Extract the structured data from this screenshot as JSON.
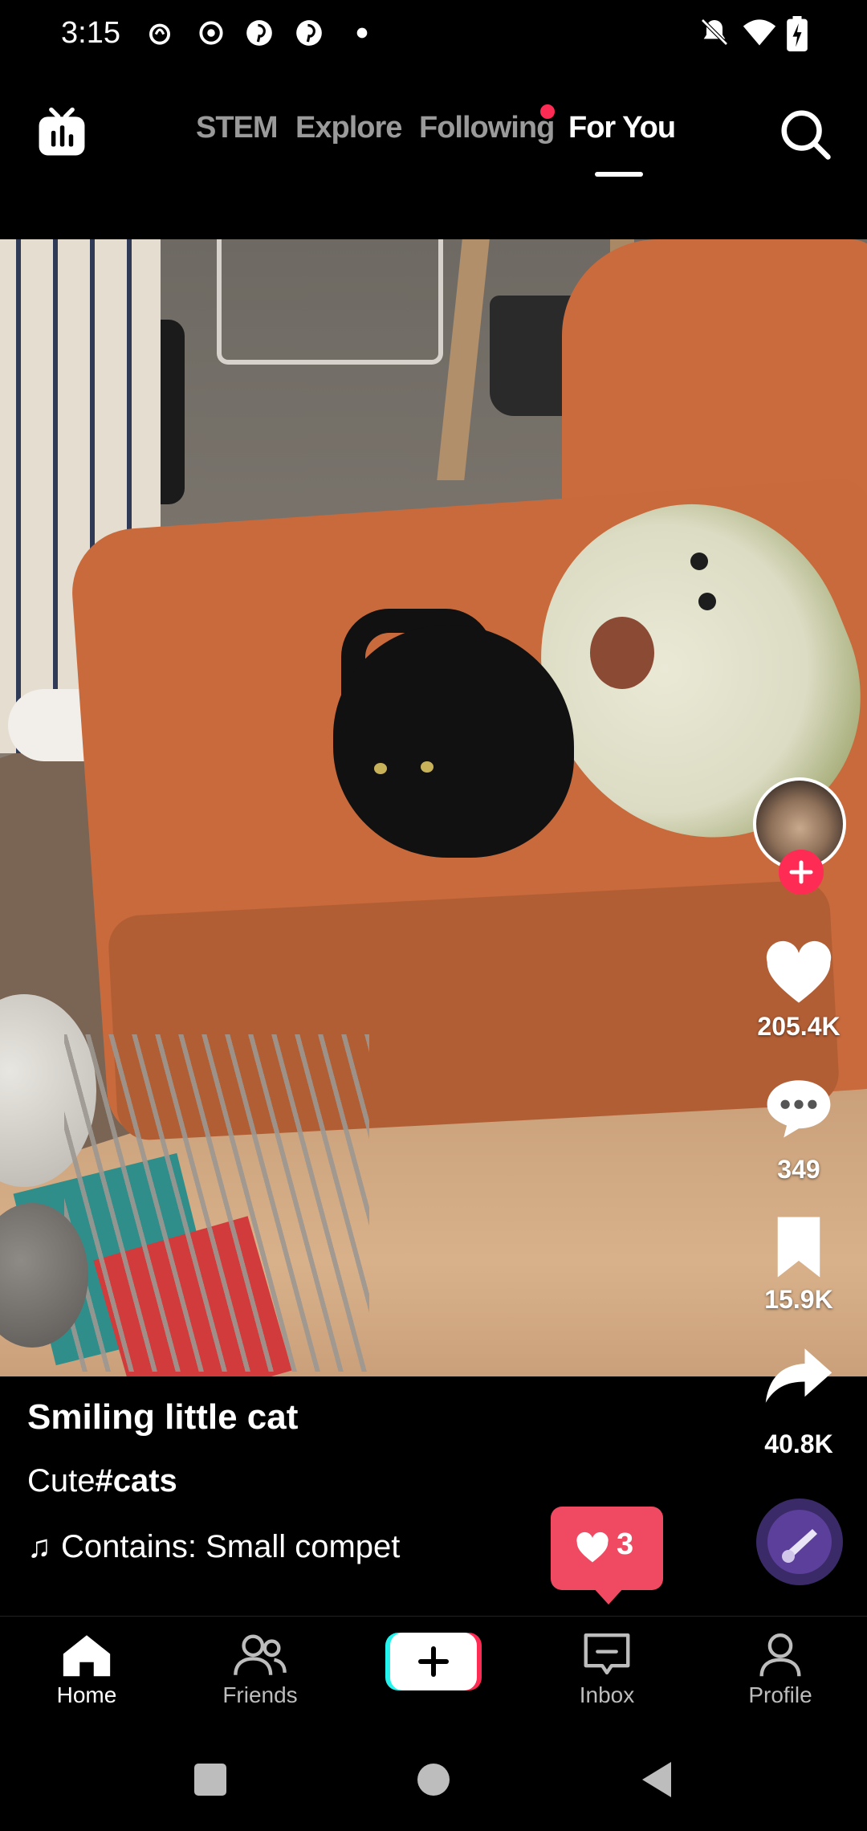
{
  "status_bar": {
    "time": "3:15",
    "left_icons": [
      "threads-icon",
      "circle-icon",
      "pinterest-icon",
      "pinterest-icon",
      "dot-icon"
    ],
    "right_icons": [
      "mute-icon",
      "wifi-icon",
      "battery-charging-icon"
    ]
  },
  "top_nav": {
    "tabs": [
      {
        "label": "STEM",
        "active": false
      },
      {
        "label": "Explore",
        "active": false
      },
      {
        "label": "Following",
        "active": false,
        "has_dot": true
      },
      {
        "label": "For You",
        "active": true
      }
    ]
  },
  "actions": {
    "likes": "205.4K",
    "comments": "349",
    "favorites": "15.9K",
    "shares": "40.8K"
  },
  "caption": {
    "title": "Smiling little cat",
    "text": "Cute",
    "hashtag": "#cats",
    "music": "Contains: Small compet"
  },
  "like_toast": {
    "count": "3"
  },
  "bottom_nav": {
    "items": [
      {
        "label": "Home",
        "active": true
      },
      {
        "label": "Friends",
        "active": false
      },
      {
        "label": "",
        "active": false
      },
      {
        "label": "Inbox",
        "active": false
      },
      {
        "label": "Profile",
        "active": false
      }
    ]
  },
  "colors": {
    "accent": "#fe2c55",
    "toast": "#f04a63",
    "inactive_tab": "#9a9a9a"
  }
}
